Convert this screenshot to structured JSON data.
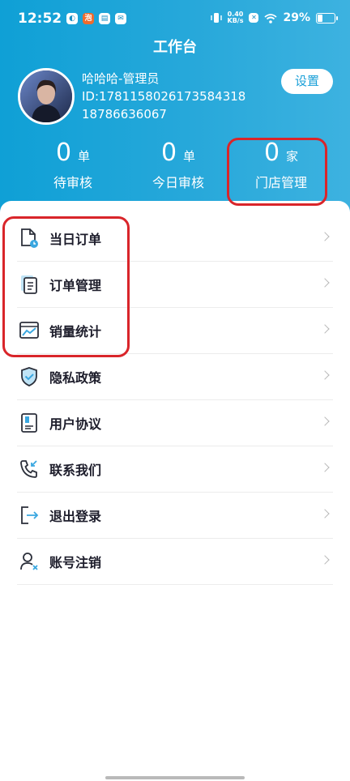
{
  "status_bar": {
    "time": "12:52",
    "icons_left": [
      "logo-icon",
      "app-badge-icon",
      "calendar-icon",
      "message-icon"
    ],
    "net_speed_value": "0.40",
    "net_speed_unit": "KB/s",
    "battery_percent": "29%"
  },
  "header": {
    "title": "工作台"
  },
  "profile": {
    "name_role": "哈哈哈-管理员",
    "id_line": "ID:1781158026173584318",
    "phone": "18786636067",
    "settings_label": "设置"
  },
  "stats": [
    {
      "value": "0",
      "unit": "单",
      "label": "待审核"
    },
    {
      "value": "0",
      "unit": "单",
      "label": "今日审核"
    },
    {
      "value": "0",
      "unit": "家",
      "label": "门店管理"
    }
  ],
  "menu": [
    {
      "label": "当日订单",
      "icon": "daily-order-icon"
    },
    {
      "label": "订单管理",
      "icon": "order-management-icon"
    },
    {
      "label": "销量统计",
      "icon": "sales-statistics-icon"
    },
    {
      "label": "隐私政策",
      "icon": "privacy-shield-icon"
    },
    {
      "label": "用户协议",
      "icon": "user-agreement-icon"
    },
    {
      "label": "联系我们",
      "icon": "phone-call-icon"
    },
    {
      "label": "退出登录",
      "icon": "logout-icon"
    },
    {
      "label": "账号注销",
      "icon": "account-cancel-icon"
    }
  ],
  "colors": {
    "header_start": "#0fa0d6",
    "header_end": "#3db2e0",
    "accent_blue": "#1aa0d8",
    "annotation_red": "#d9252a"
  }
}
